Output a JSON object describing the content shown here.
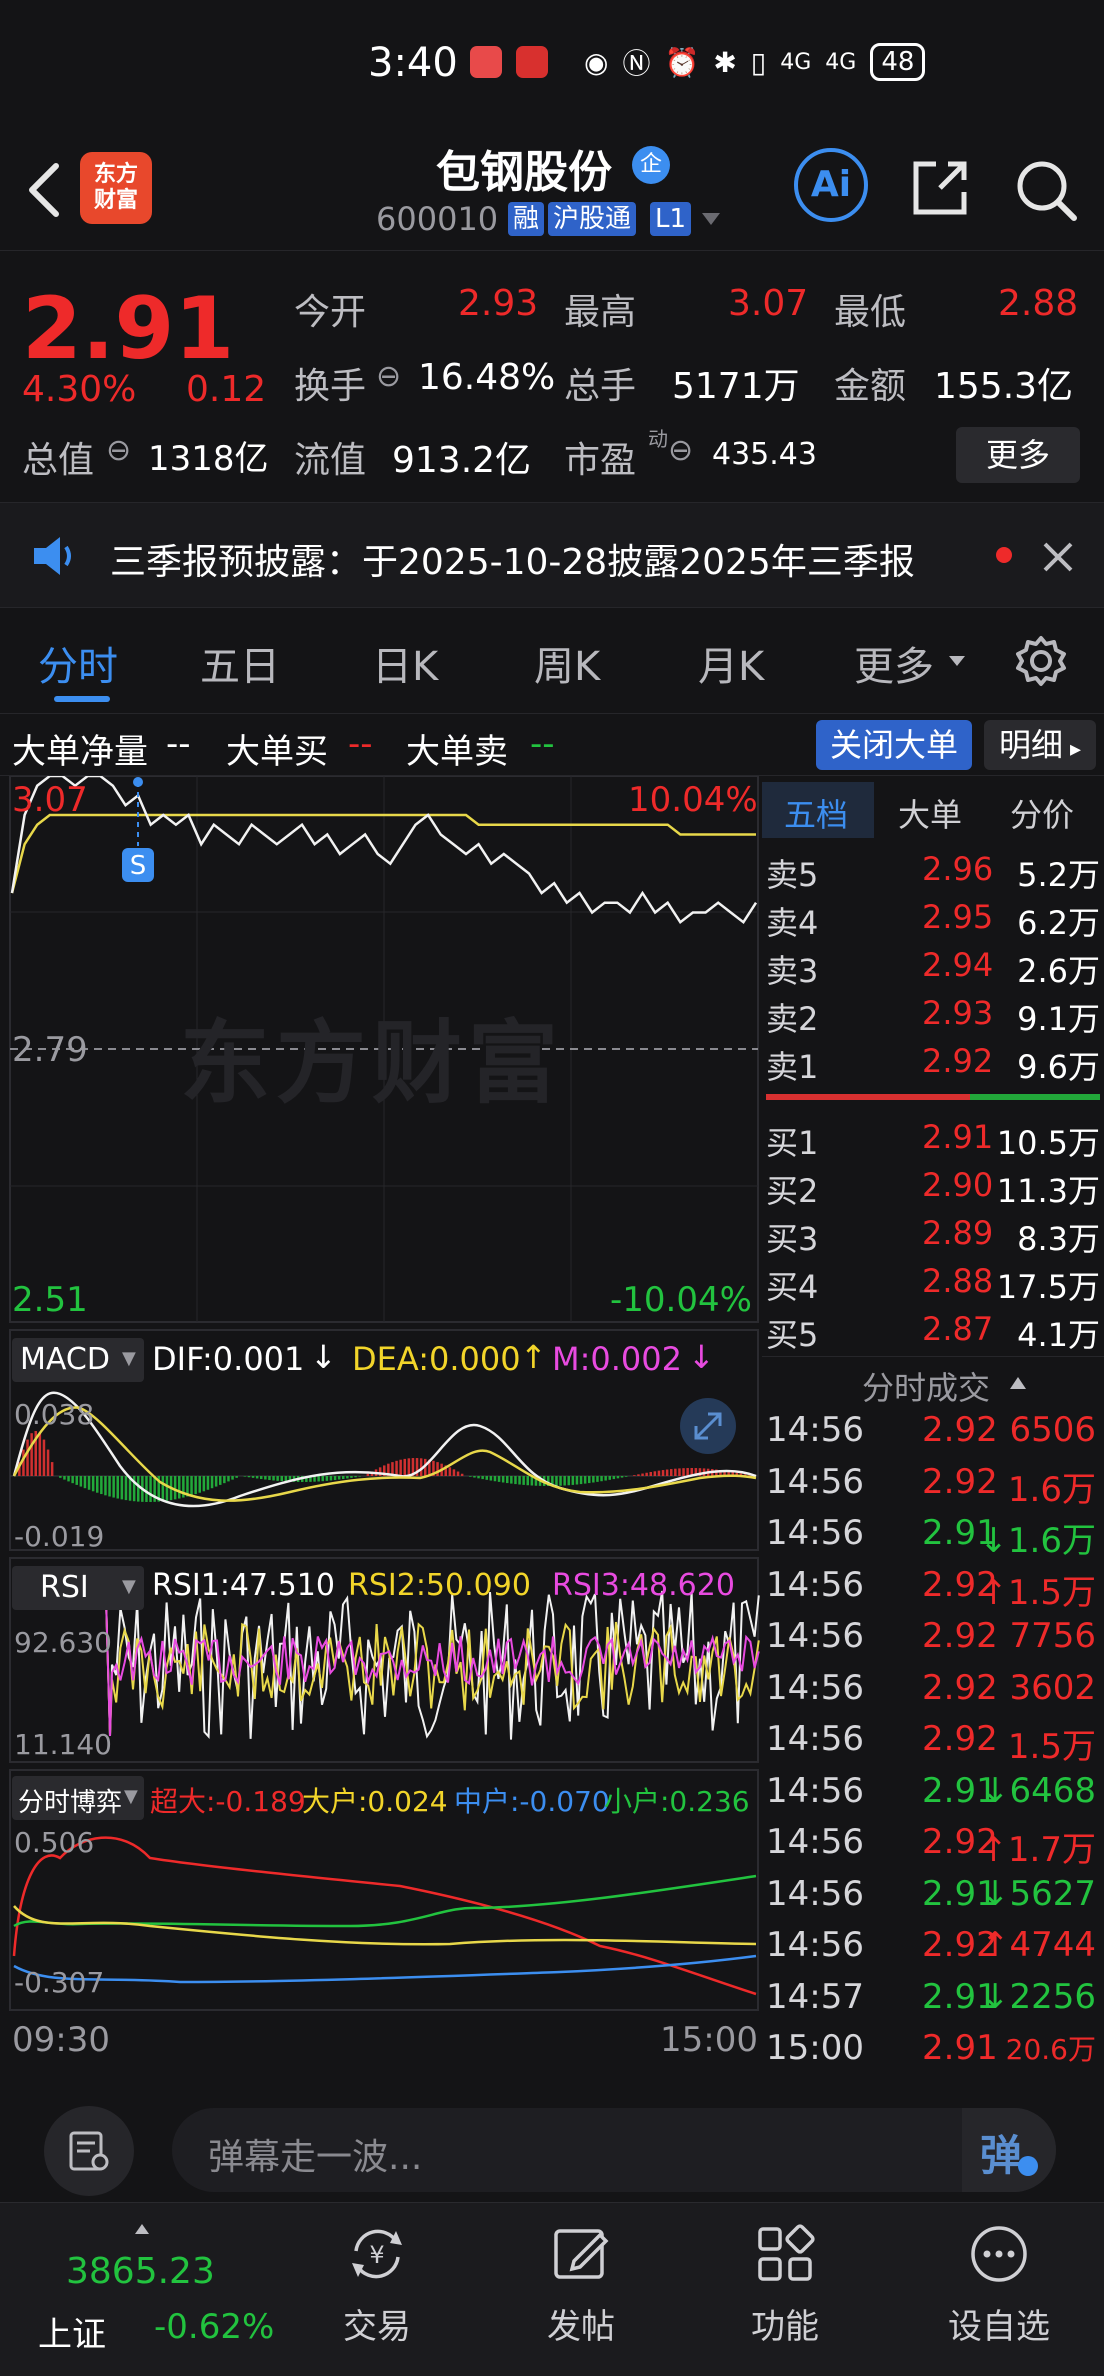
{
  "status_bar": {
    "time": "3:40",
    "battery": "48",
    "signal1": "4G",
    "signal2": "4G"
  },
  "header": {
    "stock_name": "包钢股份",
    "enterprise_badge": "企",
    "stock_code": "600010",
    "tag_margin": "融",
    "tag_connect": "沪股通",
    "tag_level": "L1",
    "logo_line1": "东方",
    "logo_line2": "财富",
    "ai_label": "Ai"
  },
  "quote": {
    "price": "2.91",
    "change_pct": "4.30%",
    "change_amt": "0.12",
    "open_label": "今开",
    "open": "2.93",
    "high_label": "最高",
    "high": "3.07",
    "low_label": "最低",
    "low": "2.88",
    "turnover_label": "换手",
    "turnover": "16.48%",
    "volume_label": "总手",
    "volume": "5171万",
    "amount_label": "金额",
    "amount": "155.3亿",
    "mktcap_label": "总值",
    "mktcap": "1318亿",
    "float_label": "流值",
    "float_cap": "913.2亿",
    "pe_label": "市盈",
    "pe_sup": "动",
    "pe": "435.43",
    "more_label": "更多"
  },
  "notice": {
    "text": "三季报预披露：于2025-10-28披露2025年三季报"
  },
  "tabs": [
    "分时",
    "五日",
    "日K",
    "周K",
    "月K",
    "更多"
  ],
  "big_order": {
    "net_label": "大单净量",
    "net_value": "--",
    "buy_label": "大单买",
    "buy_value": "--",
    "sell_label": "大单卖",
    "sell_value": "--",
    "close_label": "关闭大单",
    "detail_label": "明细"
  },
  "chart_data": [
    {
      "type": "line",
      "name": "intraday",
      "y_labels": {
        "top": "3.07",
        "mid": "2.79",
        "bottom": "2.51",
        "top_pct": "10.04%",
        "bottom_pct": "-10.04%"
      },
      "marker_label": "S",
      "watermark": "东方财富",
      "x_labels": {
        "start": "09:30",
        "end": "15:00"
      },
      "ylim": [
        2.51,
        3.07
      ],
      "price": [
        2.95,
        3.03,
        3.06,
        3.07,
        3.07,
        3.06,
        3.07,
        3.07,
        3.06,
        3.04,
        3.05,
        3.02,
        3.03,
        3.02,
        3.03,
        3.0,
        3.02,
        3.01,
        3.0,
        3.02,
        3.01,
        3.0,
        3.01,
        3.02,
        3.0,
        3.01,
        2.99,
        3.0,
        3.01,
        2.99,
        2.98,
        3.0,
        3.02,
        3.03,
        3.01,
        3.0,
        2.99,
        3.0,
        2.98,
        2.99,
        2.98,
        2.97,
        2.95,
        2.96,
        2.94,
        2.95,
        2.93,
        2.94,
        2.94,
        2.93,
        2.95,
        2.93,
        2.94,
        2.92,
        2.93,
        2.93,
        2.94,
        2.93,
        2.92,
        2.94
      ],
      "avg": [
        2.95,
        3.0,
        3.02,
        3.03,
        3.03,
        3.03,
        3.03,
        3.03,
        3.03,
        3.03,
        3.03,
        3.03,
        3.03,
        3.03,
        3.03,
        3.03,
        3.03,
        3.03,
        3.03,
        3.03,
        3.03,
        3.03,
        3.03,
        3.03,
        3.03,
        3.03,
        3.03,
        3.03,
        3.03,
        3.03,
        3.03,
        3.03,
        3.03,
        3.03,
        3.03,
        3.03,
        3.03,
        3.02,
        3.02,
        3.02,
        3.02,
        3.02,
        3.02,
        3.02,
        3.02,
        3.02,
        3.02,
        3.02,
        3.02,
        3.02,
        3.02,
        3.02,
        3.02,
        3.01,
        3.01,
        3.01,
        3.01,
        3.01,
        3.01,
        3.01
      ]
    },
    {
      "type": "line",
      "name": "macd",
      "label": "MACD",
      "dif": "DIF:0.001",
      "dea": "DEA:0.000",
      "m": "M:0.002",
      "y_labels": {
        "top": "0.038",
        "bottom": "-0.019"
      },
      "ylim": [
        -0.019,
        0.038
      ]
    },
    {
      "type": "line",
      "name": "rsi",
      "label": "RSI",
      "rsi1": "RSI1:47.510",
      "rsi2": "RSI2:50.090",
      "rsi3": "RSI3:48.620",
      "y_labels": {
        "top": "92.630",
        "bottom": "11.140"
      },
      "ylim": [
        11.14,
        92.63
      ]
    },
    {
      "type": "line",
      "name": "fund_flow",
      "label": "分时博弈",
      "super": "超大:-0.189",
      "large": "大户:0.024",
      "medium": "中户:-0.070",
      "small": "小户:0.236",
      "y_labels": {
        "top": "0.506",
        "bottom": "-0.307"
      },
      "ylim": [
        -0.307,
        0.506
      ]
    }
  ],
  "order_book": {
    "tabs": [
      "五档",
      "大单",
      "分价"
    ],
    "asks": [
      {
        "label": "卖5",
        "price": "2.96",
        "vol": "5.2万"
      },
      {
        "label": "卖4",
        "price": "2.95",
        "vol": "6.2万"
      },
      {
        "label": "卖3",
        "price": "2.94",
        "vol": "2.6万"
      },
      {
        "label": "卖2",
        "price": "2.93",
        "vol": "9.1万"
      },
      {
        "label": "卖1",
        "price": "2.92",
        "vol": "9.6万"
      }
    ],
    "bids": [
      {
        "label": "买1",
        "price": "2.91",
        "vol": "10.5万"
      },
      {
        "label": "买2",
        "price": "2.90",
        "vol": "11.3万"
      },
      {
        "label": "买3",
        "price": "2.89",
        "vol": "8.3万"
      },
      {
        "label": "买4",
        "price": "2.88",
        "vol": "17.5万"
      },
      {
        "label": "买5",
        "price": "2.87",
        "vol": "4.1万"
      }
    ]
  },
  "trades": {
    "title": "分时成交",
    "rows": [
      {
        "time": "14:56",
        "price": "2.92",
        "vol": "6506",
        "dir": ""
      },
      {
        "time": "14:56",
        "price": "2.92",
        "vol": "1.6万",
        "dir": ""
      },
      {
        "time": "14:56",
        "price": "2.91",
        "vol": "1.6万",
        "dir": "↓"
      },
      {
        "time": "14:56",
        "price": "2.92",
        "vol": "1.5万",
        "dir": "↑"
      },
      {
        "time": "14:56",
        "price": "2.92",
        "vol": "7756",
        "dir": ""
      },
      {
        "time": "14:56",
        "price": "2.92",
        "vol": "3602",
        "dir": ""
      },
      {
        "time": "14:56",
        "price": "2.92",
        "vol": "1.5万",
        "dir": ""
      },
      {
        "time": "14:56",
        "price": "2.91",
        "vol": "6468",
        "dir": "↓"
      },
      {
        "time": "14:56",
        "price": "2.92",
        "vol": "1.7万",
        "dir": "↑"
      },
      {
        "time": "14:56",
        "price": "2.91",
        "vol": "5627",
        "dir": "↓"
      },
      {
        "time": "14:56",
        "price": "2.92",
        "vol": "4744",
        "dir": "↑"
      },
      {
        "time": "14:57",
        "price": "2.91",
        "vol": "2256",
        "dir": "↓"
      },
      {
        "time": "15:00",
        "price": "2.91",
        "vol": "20.6万",
        "dir": ""
      }
    ]
  },
  "comment": {
    "placeholder": "弹幕走一波...",
    "danmu_icon": "弹"
  },
  "bottom_nav": {
    "index_value": "3865.23",
    "index_name": "上证",
    "index_change": "-0.62%",
    "items": [
      "交易",
      "发帖",
      "功能",
      "设自选"
    ]
  },
  "colors": {
    "up": "#ee2a2a",
    "down": "#22c33f",
    "accent": "#3c8ef0",
    "avg": "#e8d84a"
  }
}
